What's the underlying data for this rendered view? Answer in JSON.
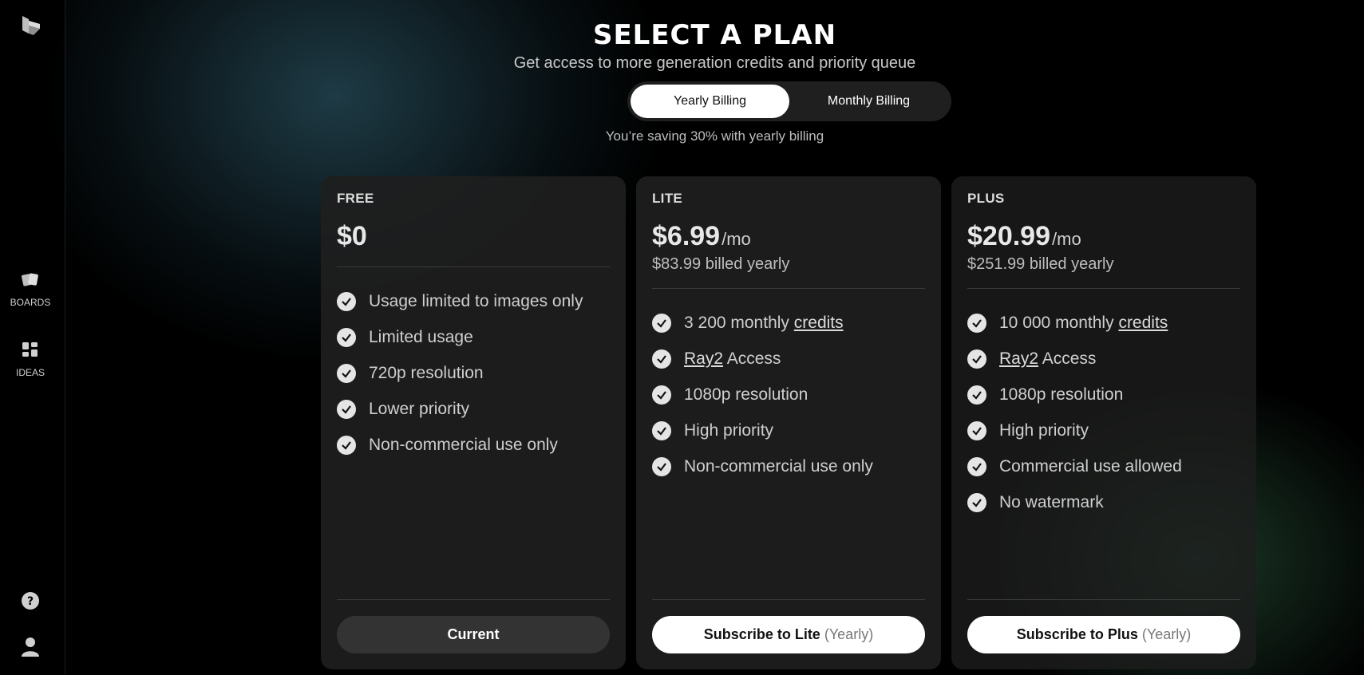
{
  "colors": {
    "background": "#000000",
    "card": "#1e1e1e",
    "accent_button": "#ffffff",
    "check": "#e5e5e5"
  },
  "sidebar": {
    "logo_icon": "luma-logo-icon",
    "items": [
      {
        "label": "BOARDS",
        "icon": "boards-icon"
      },
      {
        "label": "IDEAS",
        "icon": "ideas-grid-icon"
      }
    ],
    "help_icon": "help-icon",
    "user_icon": "user-icon"
  },
  "header": {
    "title": "SELECT A PLAN",
    "subtitle": "Get access to more generation credits and priority queue"
  },
  "billing_toggle": {
    "options": [
      "Yearly Billing",
      "Monthly Billing"
    ],
    "selected": "Yearly Billing",
    "note": "You’re saving 30% with yearly billing"
  },
  "plans": [
    {
      "name": "FREE",
      "price": "$0",
      "per": "",
      "billed": "",
      "features": [
        {
          "text": "Usage limited to images only"
        },
        {
          "text": "Limited usage"
        },
        {
          "text": "720p resolution"
        },
        {
          "text": "Lower priority"
        },
        {
          "text": "Non-commercial use only"
        }
      ],
      "button": {
        "label": "Current",
        "suffix": ""
      }
    },
    {
      "name": "LITE",
      "price": "$6.99",
      "per": "/mo",
      "billed": "$83.99 billed yearly",
      "features": [
        {
          "pre": "3 200 monthly ",
          "link": "credits",
          "post": ""
        },
        {
          "pre": "",
          "link": "Ray2",
          "post": " Access"
        },
        {
          "text": "1080p resolution"
        },
        {
          "text": "High priority"
        },
        {
          "text": "Non-commercial use only"
        }
      ],
      "button": {
        "label": "Subscribe to Lite",
        "suffix": "(Yearly)"
      }
    },
    {
      "name": "PLUS",
      "price": "$20.99",
      "per": "/mo",
      "billed": "$251.99 billed yearly",
      "features": [
        {
          "pre": "10 000 monthly ",
          "link": "credits",
          "post": ""
        },
        {
          "pre": "",
          "link": "Ray2",
          "post": " Access"
        },
        {
          "text": "1080p resolution"
        },
        {
          "text": "High priority"
        },
        {
          "text": "Commercial use allowed"
        },
        {
          "text": "No watermark"
        }
      ],
      "button": {
        "label": "Subscribe to Plus",
        "suffix": "(Yearly)"
      }
    }
  ]
}
